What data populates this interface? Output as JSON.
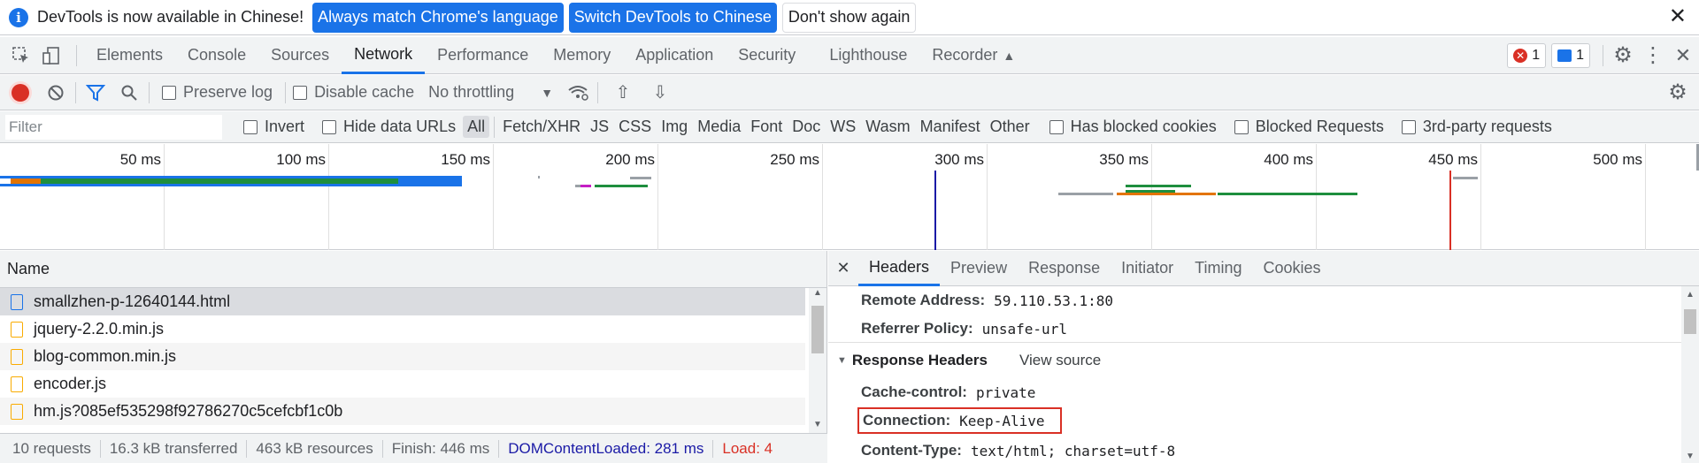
{
  "infobar": {
    "message": "DevTools is now available in Chinese!",
    "btn_match": "Always match Chrome's language",
    "btn_switch": "Switch DevTools to Chinese",
    "btn_dont_show": "Don't show again",
    "close": "✕"
  },
  "main_tabs": [
    "Elements",
    "Console",
    "Sources",
    "Network",
    "Performance",
    "Memory",
    "Application",
    "Security",
    "Lighthouse",
    "Recorder"
  ],
  "active_main_tab": "Network",
  "badges": {
    "errors": "1",
    "messages": "1"
  },
  "network_toolbar": {
    "preserve_log": "Preserve log",
    "disable_cache": "Disable cache",
    "throttling": "No throttling"
  },
  "filterbar": {
    "placeholder": "Filter",
    "invert": "Invert",
    "hide_data_urls": "Hide data URLs",
    "types": [
      "All",
      "Fetch/XHR",
      "JS",
      "CSS",
      "Img",
      "Media",
      "Font",
      "Doc",
      "WS",
      "Wasm",
      "Manifest",
      "Other"
    ],
    "has_blocked_cookies": "Has blocked cookies",
    "blocked_requests": "Blocked Requests",
    "third_party": "3rd-party requests"
  },
  "overview": {
    "ticks": [
      "50 ms",
      "100 ms",
      "150 ms",
      "200 ms",
      "250 ms",
      "300 ms",
      "350 ms",
      "400 ms",
      "450 ms",
      "500 ms"
    ],
    "dom_content_loaded_ms": 281,
    "load_ms": 440
  },
  "request_list": {
    "header": "Name",
    "rows": [
      {
        "name": "smallzhen-p-12640144.html",
        "type": "html"
      },
      {
        "name": "jquery-2.2.0.min.js",
        "type": "js"
      },
      {
        "name": "blog-common.min.js",
        "type": "js"
      },
      {
        "name": "encoder.js",
        "type": "js"
      },
      {
        "name": "hm.js?085ef535298f92786270c5cefcbf1c0b",
        "type": "js"
      }
    ]
  },
  "statusbar": {
    "requests": "10 requests",
    "transferred": "16.3 kB transferred",
    "resources": "463 kB resources",
    "finish": "Finish: 446 ms",
    "dcl": "DOMContentLoaded: 281 ms",
    "load": "Load: 4"
  },
  "detail": {
    "tabs": [
      "Headers",
      "Preview",
      "Response",
      "Initiator",
      "Timing",
      "Cookies"
    ],
    "active_tab": "Headers",
    "close": "✕",
    "remote_address_key": "Remote Address:",
    "remote_address_val": "59.110.53.1:80",
    "referrer_key": "Referrer Policy:",
    "referrer_val": "unsafe-url",
    "response_headers_title": "Response Headers",
    "view_source": "View source",
    "headers": [
      {
        "key": "Cache-control:",
        "value": "private"
      },
      {
        "key": "Connection:",
        "value": "Keep-Alive"
      },
      {
        "key": "Content-Type:",
        "value": "text/html; charset=utf-8"
      }
    ]
  },
  "colors": {
    "accent": "#1a73e8",
    "highlight_box": "#d93025",
    "bar_blue": "#1a73e8",
    "bar_green": "#1e8e3e",
    "bar_orange": "#e37400",
    "bar_magenta": "#c51ec5",
    "bar_gray": "#9aa0a6"
  }
}
